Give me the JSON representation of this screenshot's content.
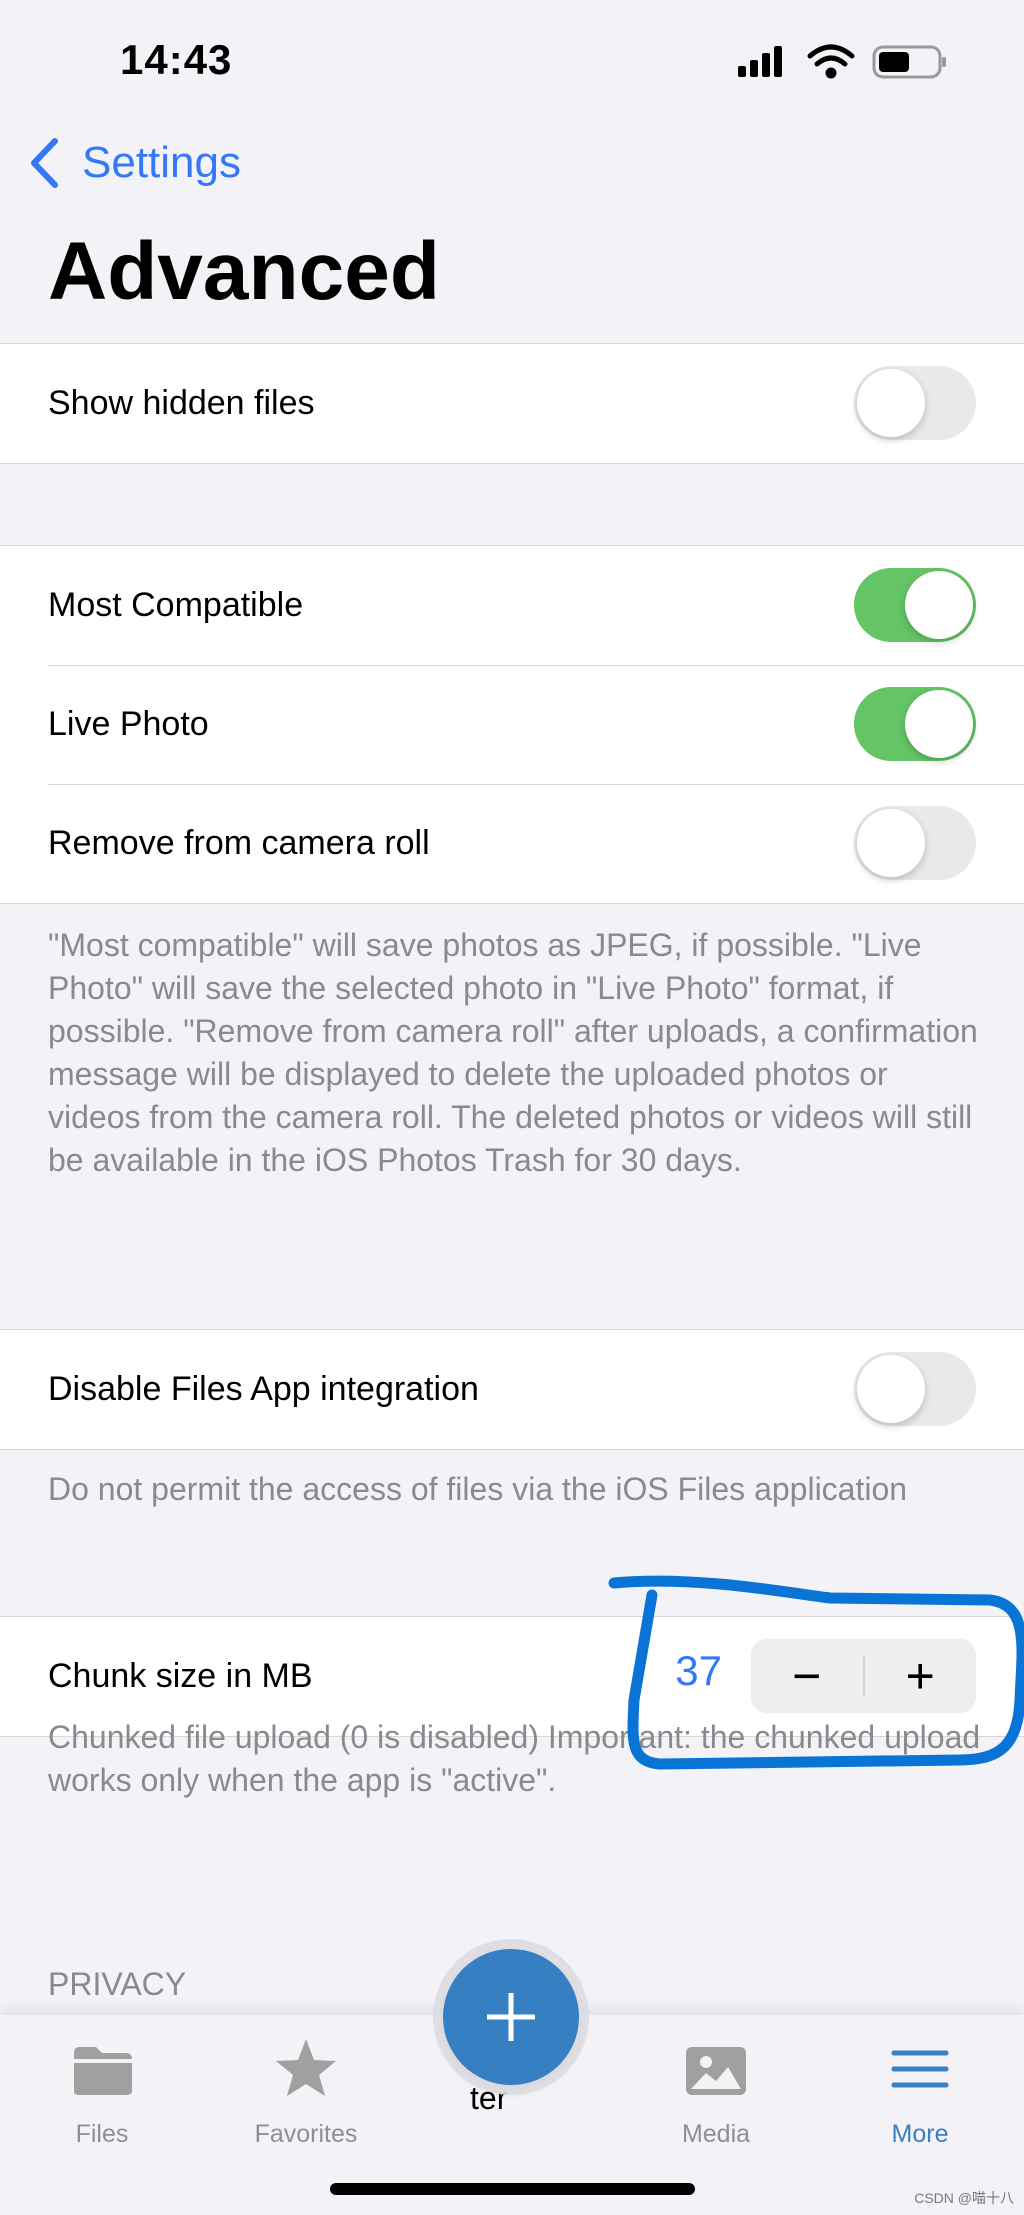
{
  "status_bar": {
    "time": "14:43"
  },
  "nav": {
    "back_label": "Settings",
    "title": "Advanced"
  },
  "section1": {
    "rows": [
      {
        "label": "Show hidden files",
        "on": false
      }
    ]
  },
  "section2": {
    "rows": [
      {
        "label": "Most Compatible",
        "on": true
      },
      {
        "label": "Live Photo",
        "on": true
      },
      {
        "label": "Remove from camera roll",
        "on": false
      }
    ],
    "footer": "\"Most compatible\" will save photos as JPEG, if possible. \"Live Photo\" will save the selected photo in \"Live Photo\" format, if possible. \"Remove from camera roll\" after uploads, a confirmation message will be displayed to delete the uploaded photos or videos from the camera roll. The deleted photos or videos will still be available in the iOS Photos Trash for 30 days."
  },
  "section3": {
    "rows": [
      {
        "label": "Disable Files App integration",
        "on": false
      }
    ],
    "footer": "Do not permit the access of files via the iOS Files application"
  },
  "section4": {
    "label": "Chunk size in MB",
    "value": "37",
    "minus": "−",
    "plus": "+",
    "footer": "Chunked file upload (0 is disabled) Important: the chunked upload works only when the app is \"active\"."
  },
  "privacy_header": "PRIVACY",
  "tabbar": {
    "files": "Files",
    "favorites": "Favorites",
    "center_partial": "ter",
    "media": "Media",
    "more": "More"
  },
  "watermark": "CSDN @喵十八",
  "colors": {
    "accent": "#3478f6",
    "toggle_on": "#65c466",
    "fab": "#377fc3",
    "annotation": "#0a74d6",
    "tab_active": "#3a7fc4"
  }
}
